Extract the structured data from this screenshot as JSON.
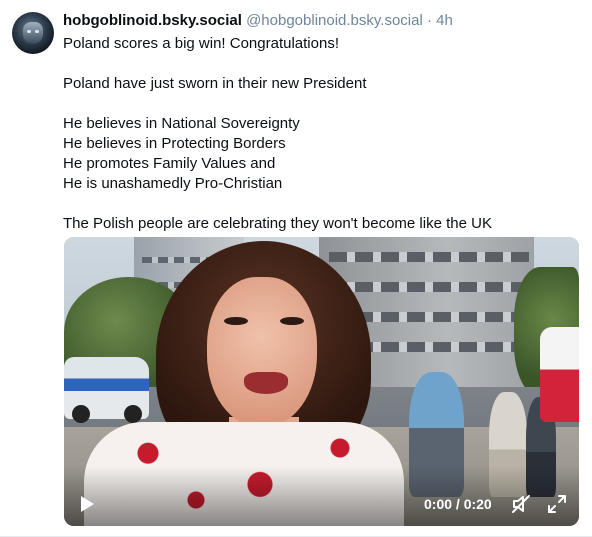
{
  "post": {
    "display_name": "hobgoblinoid.bsky.social",
    "handle": "@hobgoblinoid.bsky.social",
    "separator": "·",
    "time": "4h",
    "lines": [
      "Poland scores a big win! Congratulations!",
      "",
      "Poland have just sworn in their new President",
      "",
      "He believes in National Sovereignty",
      "He believes in Protecting Borders",
      "He promotes Family Values and",
      "He is unashamedly Pro-Christian",
      "",
      "The Polish people are celebrating they won't become like the UK"
    ]
  },
  "video": {
    "timecode": "0:00 / 0:20",
    "icons": [
      "play-icon",
      "mute-icon",
      "fullscreen-icon"
    ]
  }
}
